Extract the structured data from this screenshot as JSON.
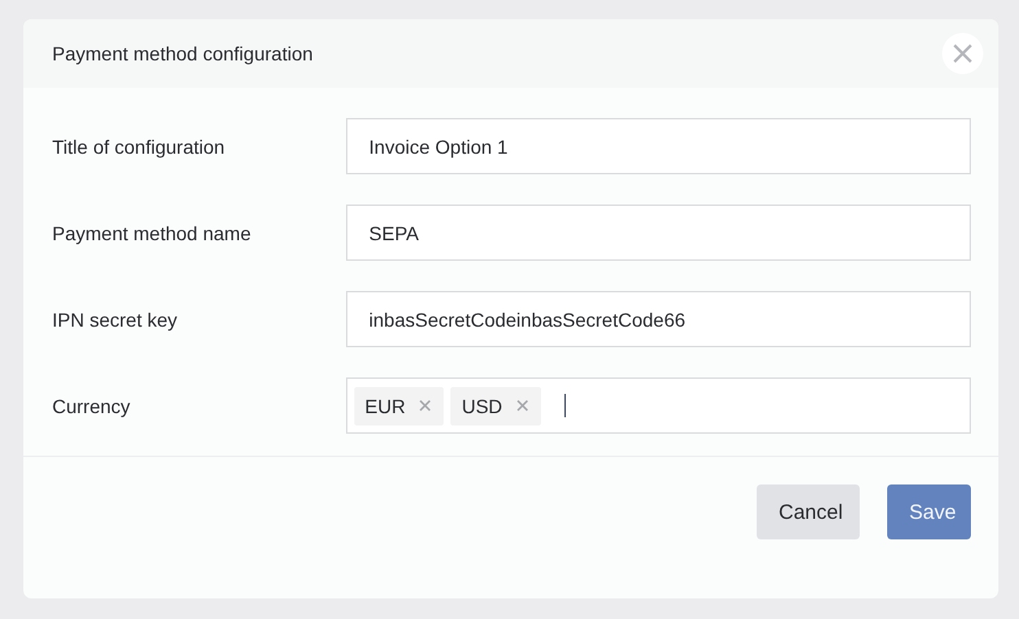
{
  "dialog": {
    "title": "Payment method configuration"
  },
  "fields": [
    {
      "kind": "text",
      "label": "Title of configuration",
      "value": "Invoice Option 1"
    },
    {
      "kind": "text",
      "label": "Payment method name",
      "value": "SEPA"
    },
    {
      "kind": "text",
      "label": "IPN secret key",
      "value": "inbasSecretCodeinbasSecretCode66"
    },
    {
      "kind": "tags",
      "label": "Currency",
      "tags": [
        "EUR",
        "USD"
      ]
    }
  ],
  "buttons": [
    {
      "kind": "secondary",
      "label": "Cancel"
    },
    {
      "kind": "primary",
      "label": "Save"
    }
  ]
}
